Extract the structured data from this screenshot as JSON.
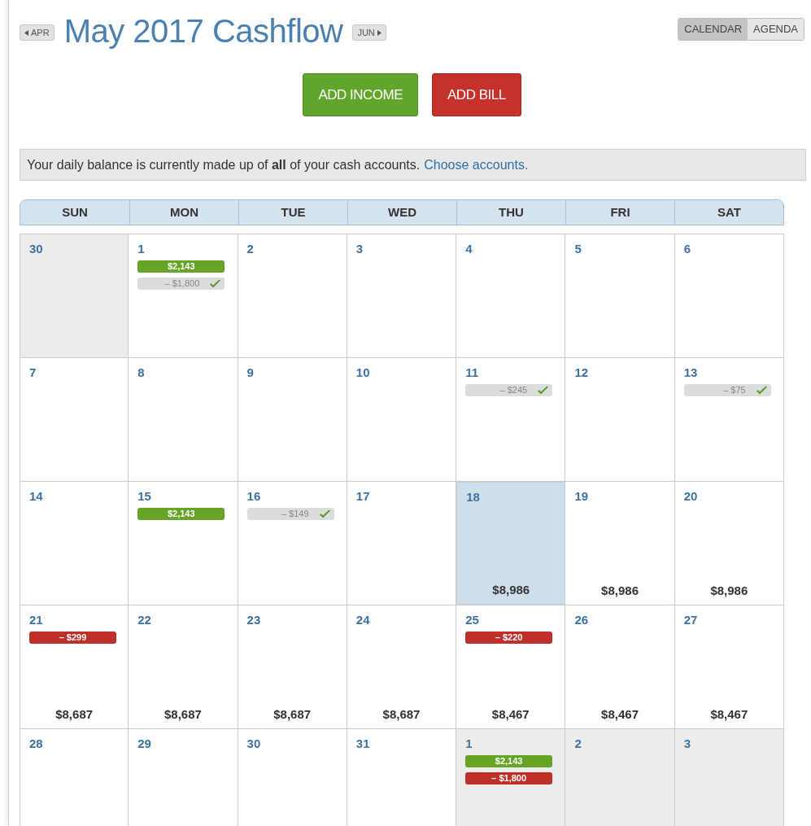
{
  "prev_month": "APR",
  "title": "May 2017 Cashflow",
  "next_month": "JUN",
  "view_tabs": [
    {
      "label": "CALENDAR",
      "selected": true
    },
    {
      "label": "AGENDA",
      "selected": false
    }
  ],
  "actions": [
    {
      "label": "ADD INCOME",
      "kind": "income"
    },
    {
      "label": "ADD BILL",
      "kind": "bill"
    }
  ],
  "notice": {
    "text": "Your daily balance is currently made up of **all** of your cash accounts.",
    "link": "Choose accounts."
  },
  "weekdays": [
    "SUN",
    "MON",
    "TUE",
    "WED",
    "THU",
    "FRI",
    "SAT"
  ],
  "weeks": [
    [
      {
        "day": "30",
        "outside": true,
        "selected": false
      },
      {
        "day": "1",
        "outside": false,
        "selected": false,
        "events": [
          {
            "kind": "income",
            "amount": "$2,143"
          },
          {
            "kind": "paid",
            "amount": "– $1,800"
          }
        ]
      },
      {
        "day": "2",
        "outside": false,
        "selected": false
      },
      {
        "day": "3",
        "outside": false,
        "selected": false
      },
      {
        "day": "4",
        "outside": false,
        "selected": false
      },
      {
        "day": "5",
        "outside": false,
        "selected": false
      },
      {
        "day": "6",
        "outside": false,
        "selected": false
      }
    ],
    [
      {
        "day": "7",
        "outside": false,
        "selected": false
      },
      {
        "day": "8",
        "outside": false,
        "selected": false
      },
      {
        "day": "9",
        "outside": false,
        "selected": false
      },
      {
        "day": "10",
        "outside": false,
        "selected": false
      },
      {
        "day": "11",
        "outside": false,
        "selected": false,
        "events": [
          {
            "kind": "paid",
            "amount": "– $245"
          }
        ]
      },
      {
        "day": "12",
        "outside": false,
        "selected": false
      },
      {
        "day": "13",
        "outside": false,
        "selected": false,
        "events": [
          {
            "kind": "paid",
            "amount": "– $75"
          }
        ]
      }
    ],
    [
      {
        "day": "14",
        "outside": false,
        "selected": false
      },
      {
        "day": "15",
        "outside": false,
        "selected": false,
        "events": [
          {
            "kind": "income",
            "amount": "$2,143"
          }
        ]
      },
      {
        "day": "16",
        "outside": false,
        "selected": false,
        "events": [
          {
            "kind": "paid",
            "amount": "– $149"
          }
        ]
      },
      {
        "day": "17",
        "outside": false,
        "selected": false
      },
      {
        "day": "18",
        "outside": false,
        "selected": true,
        "balance": "$8,986"
      },
      {
        "day": "19",
        "outside": false,
        "selected": false,
        "balance": "$8,986"
      },
      {
        "day": "20",
        "outside": false,
        "selected": false,
        "balance": "$8,986"
      }
    ],
    [
      {
        "day": "21",
        "outside": false,
        "selected": false,
        "events": [
          {
            "kind": "bill",
            "amount": "– $299"
          }
        ],
        "balance": "$8,687"
      },
      {
        "day": "22",
        "outside": false,
        "selected": false,
        "balance": "$8,687"
      },
      {
        "day": "23",
        "outside": false,
        "selected": false,
        "balance": "$8,687"
      },
      {
        "day": "24",
        "outside": false,
        "selected": false,
        "balance": "$8,687"
      },
      {
        "day": "25",
        "outside": false,
        "selected": false,
        "events": [
          {
            "kind": "bill",
            "amount": "– $220"
          }
        ],
        "balance": "$8,467"
      },
      {
        "day": "26",
        "outside": false,
        "selected": false,
        "balance": "$8,467"
      },
      {
        "day": "27",
        "outside": false,
        "selected": false,
        "balance": "$8,467"
      }
    ],
    [
      {
        "day": "28",
        "outside": false,
        "selected": false
      },
      {
        "day": "29",
        "outside": false,
        "selected": false
      },
      {
        "day": "30",
        "outside": false,
        "selected": false
      },
      {
        "day": "31",
        "outside": false,
        "selected": false
      },
      {
        "day": "1",
        "outside": true,
        "selected": false,
        "events": [
          {
            "kind": "income",
            "amount": "$2,143"
          },
          {
            "kind": "bill",
            "amount": "– $1,800"
          }
        ]
      },
      {
        "day": "2",
        "outside": true,
        "selected": false
      },
      {
        "day": "3",
        "outside": true,
        "selected": false
      }
    ]
  ]
}
